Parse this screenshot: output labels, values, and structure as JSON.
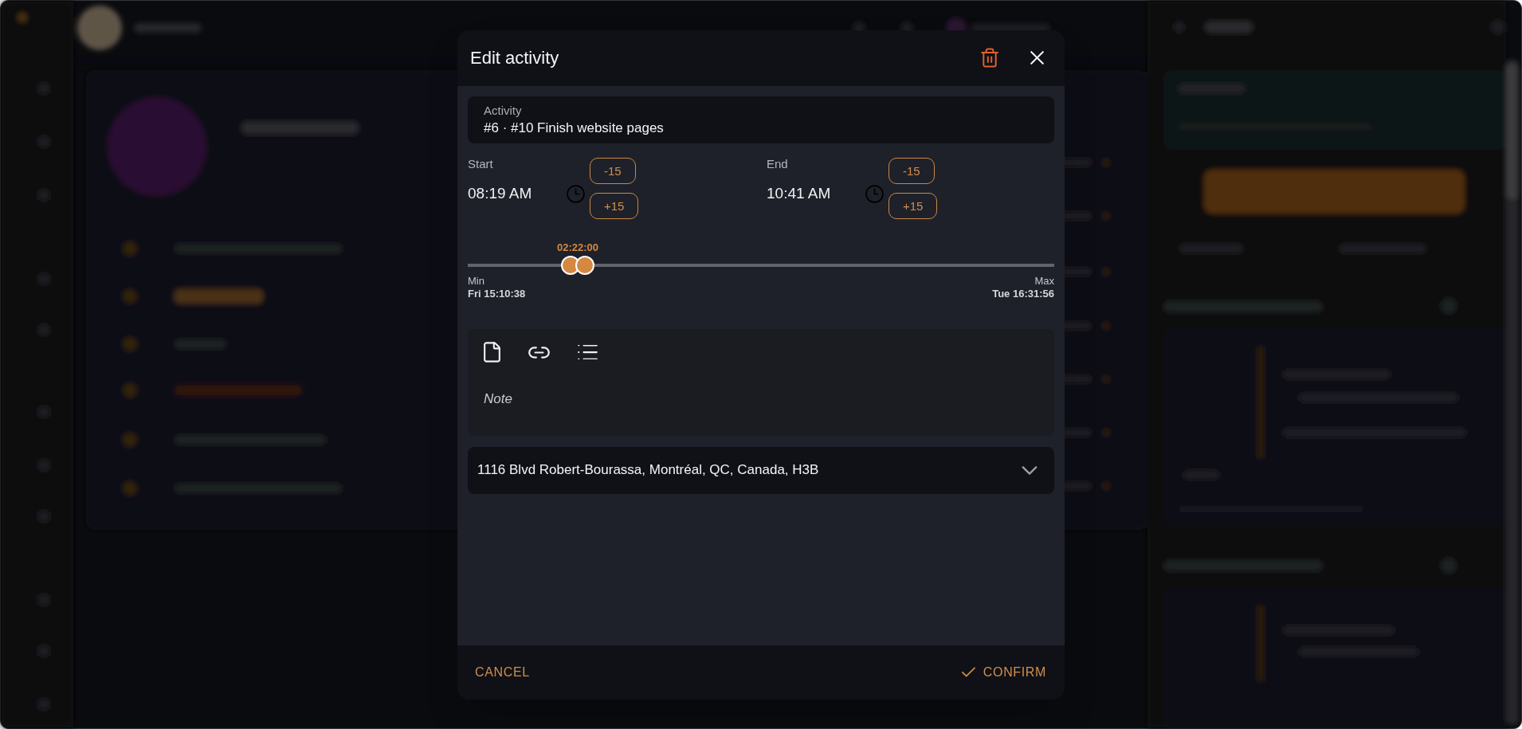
{
  "dialog": {
    "title": "Edit activity"
  },
  "activity_field": {
    "label": "Activity",
    "value": "#6 · #10 Finish website pages"
  },
  "times": [
    {
      "label": "Start",
      "value": "08:19 AM",
      "buttons": [
        "-15",
        "+15"
      ]
    },
    {
      "label": "End",
      "value": "10:41 AM",
      "buttons": [
        "-15",
        "+15"
      ]
    }
  ],
  "range_slider": {
    "duration": "02:22:00",
    "thumbs": [
      {
        "level": 0.175
      },
      {
        "level": 0.2
      }
    ],
    "min_label": "Min",
    "min_value": "Fri 15:10:38",
    "max_label": "Max",
    "max_value": "Tue 16:31:56"
  },
  "note_editor": {
    "placeholder": "Note"
  },
  "location_select": {
    "value": "1116 Blvd Robert-Bourassa, Montréal, QC, Canada, H3B"
  },
  "footer": {
    "cancel": "CANCEL",
    "confirm": "CONFIRM"
  }
}
